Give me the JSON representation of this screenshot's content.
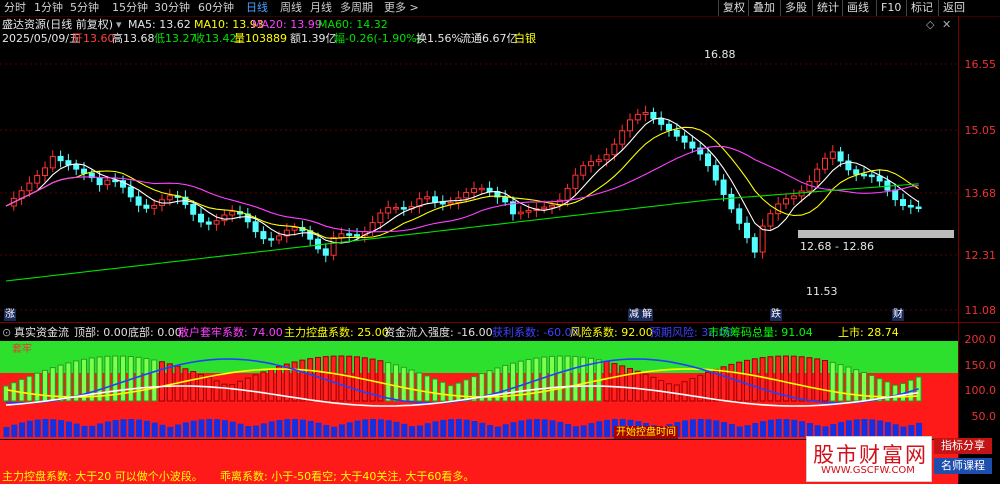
{
  "toolbar": {
    "periods": [
      "分时",
      "1分钟",
      "5分钟",
      "15分钟",
      "30分钟",
      "60分钟",
      "日线",
      "周线",
      "月线",
      "多周期",
      "更多 >"
    ],
    "active_period": "日线",
    "right_buttons": [
      "复权",
      "叠加",
      "多股",
      "统计",
      "画线",
      "F10",
      "标记",
      "返回"
    ]
  },
  "main_chart": {
    "stock_title": "盛达资源(日线 前复权)",
    "ma5": "MA5: 13.62",
    "ma10": "MA10: 13.93",
    "ma20": "MA20: 13.99",
    "ma60": "MA60: 14.32",
    "info": {
      "date": "2025/05/09/五",
      "open": "开13.60",
      "high": "高13.68",
      "low": "低13.27",
      "close": "收13.42",
      "volume": "量103889",
      "amount": "额1.39亿",
      "change": "幅-0.26(-1.90%)",
      "turnover": "换1.56%",
      "float_cap": "流通6.67亿",
      "sector": "白银"
    },
    "axis_labels": [
      "16.55",
      "15.05",
      "13.68",
      "12.31",
      "11.08"
    ],
    "annotations": {
      "high": "16.88",
      "range": "12.68 - 12.86",
      "low": "11.53"
    },
    "bottom_markers": [
      "涨",
      "减 解",
      "跌",
      "财"
    ],
    "colors": {
      "up": "#ff3232",
      "down": "#54ffff",
      "ma5": "#ffffff",
      "ma10": "#ffff00",
      "ma20": "#ff40ff",
      "ma60": "#00e000"
    }
  },
  "indicator": {
    "name": "真实资金流",
    "items": [
      {
        "text": "顶部: 0.00",
        "color": "#e0e0e0"
      },
      {
        "text": "底部: 0.00",
        "color": "#e0e0e0"
      },
      {
        "text": "散户套牢系数: 74.00",
        "color": "#ff40ff"
      },
      {
        "text": "主力控盘系数: 25.00",
        "color": "#ffff00"
      },
      {
        "text": "资金流入强度: -16.00",
        "color": "#e0e0e0"
      },
      {
        "text": "获利系数: -60.00",
        "color": "#4040ff"
      },
      {
        "text": "风险系数: 92.00",
        "color": "#ffff00"
      },
      {
        "text": "预期风险: 32.00",
        "color": "#4040ff"
      },
      {
        "text": "市场筹码总量: 91.04",
        "color": "#00ff00"
      },
      {
        "text": "上市: 28.74",
        "color": "#ffff00"
      }
    ],
    "axis_labels": [
      "200.0",
      "150.0",
      "100.0",
      "50.0"
    ],
    "corner_label": "套牢",
    "red_label": "开始控盘时间"
  },
  "bottom_text": {
    "line1": "主力控盘系数: 大于20 可以做个小波段。",
    "line2": "乖离系数: 小于-50看空; 大于40关注, 大于60看多。"
  },
  "watermark": {
    "main": "股市财富网",
    "url": "WWW.GSCFW.COM",
    "badge1": "指标分享",
    "badge2": "名师课程"
  }
}
